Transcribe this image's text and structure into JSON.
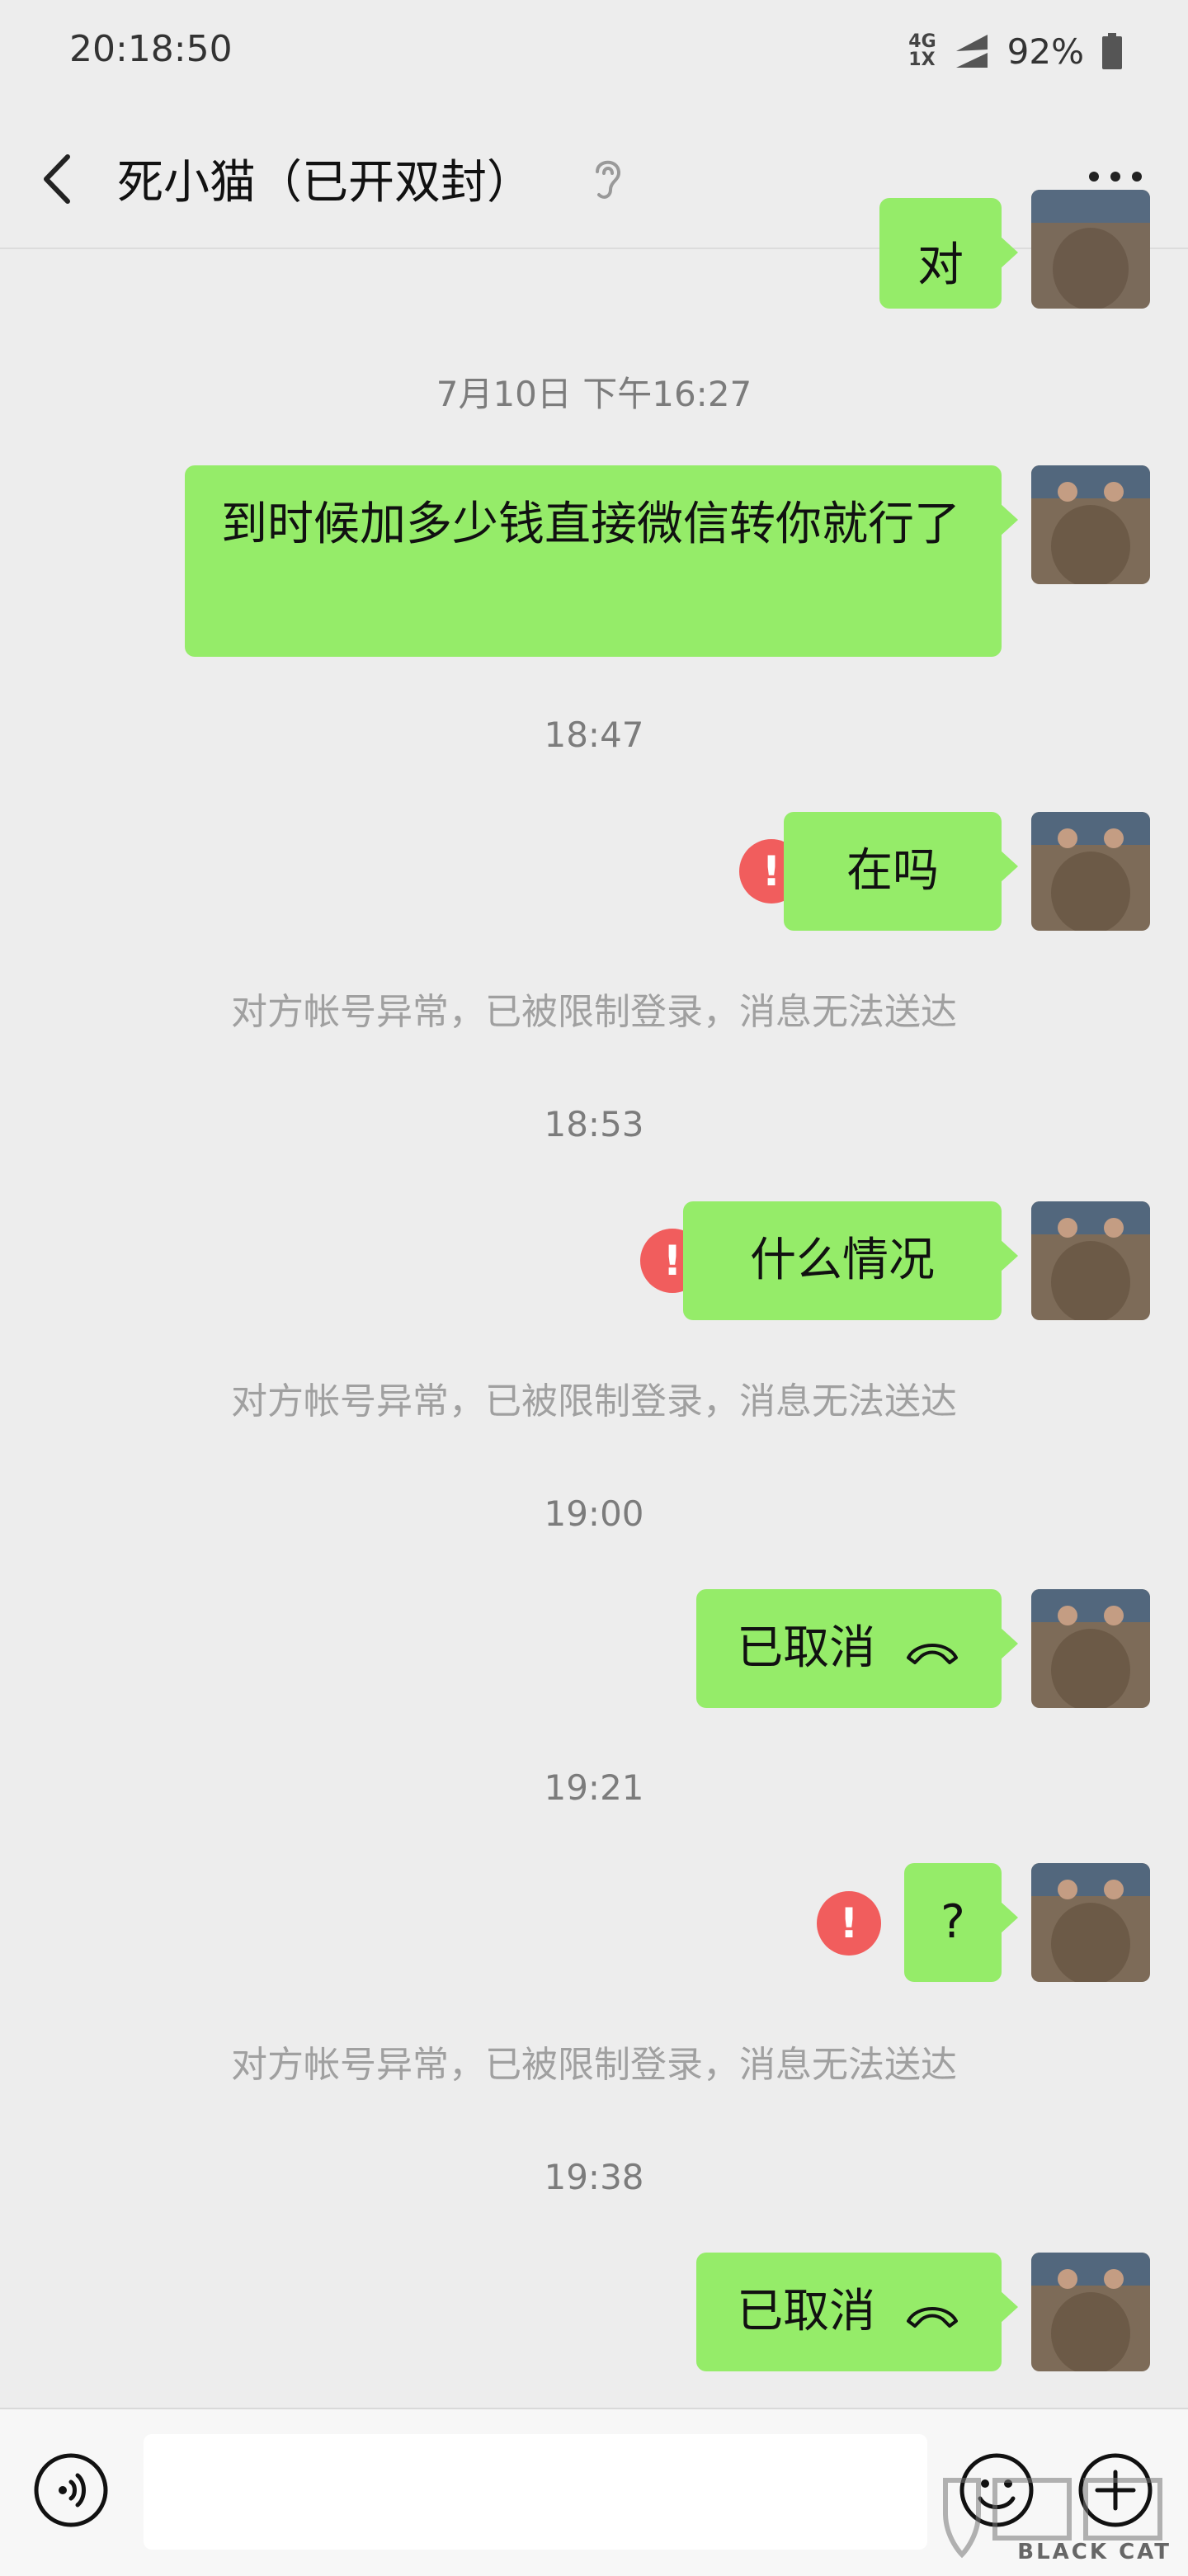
{
  "status": {
    "time": "20:18:50",
    "net_top": "4G",
    "net_bottom": "1X",
    "battery": "92%"
  },
  "header": {
    "title": "死小猫（已开双封）",
    "mode_icon": "ear-icon",
    "more_icon": "more-icon"
  },
  "messages": {
    "m0": "对",
    "ts1": "7月10日 下午16:27",
    "m1": "到时候加多少钱直接微信转你就行了",
    "ts2": "18:47",
    "m2": "在吗",
    "err2": "!",
    "note2": "对方帐号异常，已被限制登录，消息无法送达",
    "ts3": "18:53",
    "m3": "什么情况",
    "err3": "!",
    "note3": "对方帐号异常，已被限制登录，消息无法送达",
    "ts4": "19:00",
    "m4": "已取消",
    "ts5": "19:21",
    "m5": "?",
    "err5": "!",
    "note5": "对方帐号异常，已被限制登录，消息无法送达",
    "ts6": "19:38",
    "m6": "已取消"
  },
  "input": {
    "placeholder": ""
  },
  "watermark": {
    "text": "BLACK CAT"
  },
  "colors": {
    "bubble": "#95ec69",
    "error": "#f15d5d",
    "background": "#ededed"
  }
}
